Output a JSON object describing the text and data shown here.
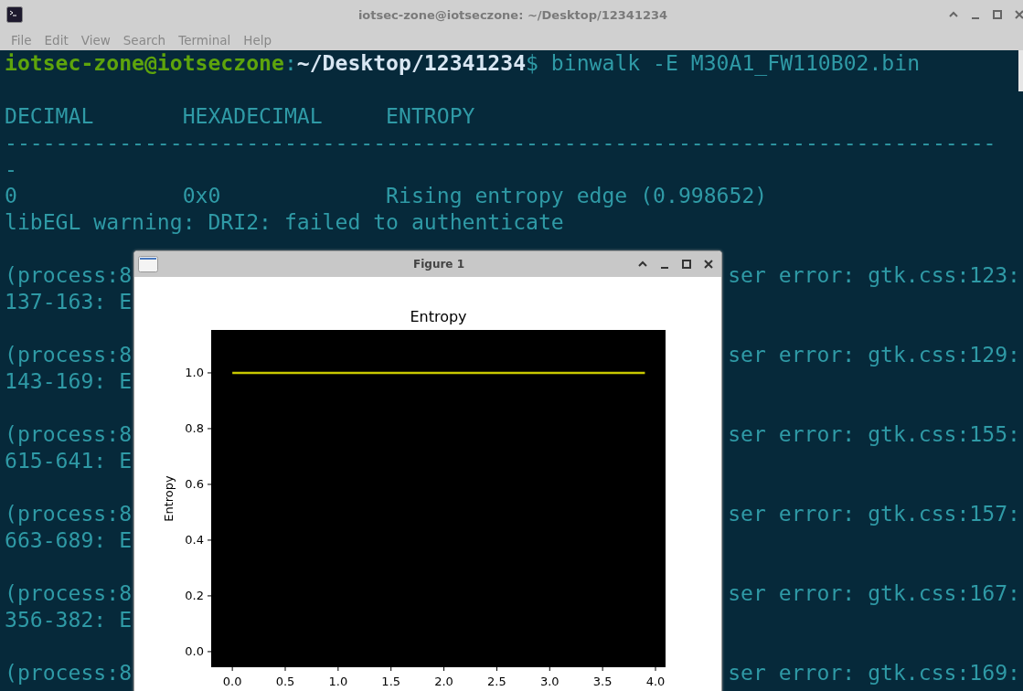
{
  "window": {
    "title": "iotsec-zone@iotseczone: ~/Desktop/12341234"
  },
  "menu": [
    "File",
    "Edit",
    "View",
    "Search",
    "Terminal",
    "Help"
  ],
  "prompt": {
    "user": "iotsec-zone@iotseczone",
    "sep": ":",
    "path": "~/Desktop/12341234",
    "symbol": "$",
    "command": " binwalk -E M30A1_FW110B02.bin"
  },
  "blocks": [
    [
      {
        "left": "DECIMAL       HEXADECIMAL     ENTROPY"
      },
      {
        "left": "------------------------------------------------------------------------------"
      },
      {
        "left": "-"
      },
      {
        "left": "0             0x0             Rising entropy edge (0.998652)"
      },
      {
        "left": "libEGL warning: DRI2: failed to authenticate"
      }
    ],
    [
      {
        "left": "(process:8",
        "right": "ser error: gtk.css:123:"
      },
      {
        "left": "137-163: E"
      }
    ],
    [
      {
        "left": "(process:8",
        "right": "ser error: gtk.css:129:"
      },
      {
        "left": "143-169: E"
      }
    ],
    [
      {
        "left": "(process:8",
        "right": "ser error: gtk.css:155:"
      },
      {
        "left": "615-641: E"
      }
    ],
    [
      {
        "left": "(process:8",
        "right": "ser error: gtk.css:157:"
      },
      {
        "left": "663-689: E"
      }
    ],
    [
      {
        "left": "(process:8",
        "right": "ser error: gtk.css:167:"
      },
      {
        "left": "356-382: E"
      }
    ],
    [
      {
        "left": "(process:8",
        "right": "ser error: gtk.css:169:"
      }
    ]
  ],
  "figure": {
    "title": "Figure 1",
    "chart_data": {
      "type": "line",
      "title": "Entropy",
      "ylabel": "Entropy",
      "x": [
        0.0,
        3.9
      ],
      "series": [
        {
          "color": "#c8c800",
          "values": [
            1.0,
            1.0
          ]
        }
      ],
      "xlim": [
        -0.2,
        4.095
      ],
      "ylim": [
        -0.056,
        1.154
      ],
      "xticks": [
        {
          "value": 0,
          "label": "0.0"
        },
        {
          "value": 0.5,
          "label": "0.5"
        },
        {
          "value": 1,
          "label": "1.0"
        },
        {
          "value": 1.5,
          "label": "1.5"
        },
        {
          "value": 2,
          "label": "2.0"
        },
        {
          "value": 2.5,
          "label": "2.5"
        },
        {
          "value": 3,
          "label": "3.0"
        },
        {
          "value": 3.5,
          "label": "3.5"
        },
        {
          "value": 4,
          "label": "4.0"
        }
      ],
      "yticks": [
        {
          "value": 0,
          "label": "0.0"
        },
        {
          "value": 0.2,
          "label": "0.2"
        },
        {
          "value": 0.4,
          "label": "0.4"
        },
        {
          "value": 0.6,
          "label": "0.6"
        },
        {
          "value": 0.8,
          "label": "0.8"
        },
        {
          "value": 1,
          "label": "1.0"
        }
      ]
    }
  }
}
